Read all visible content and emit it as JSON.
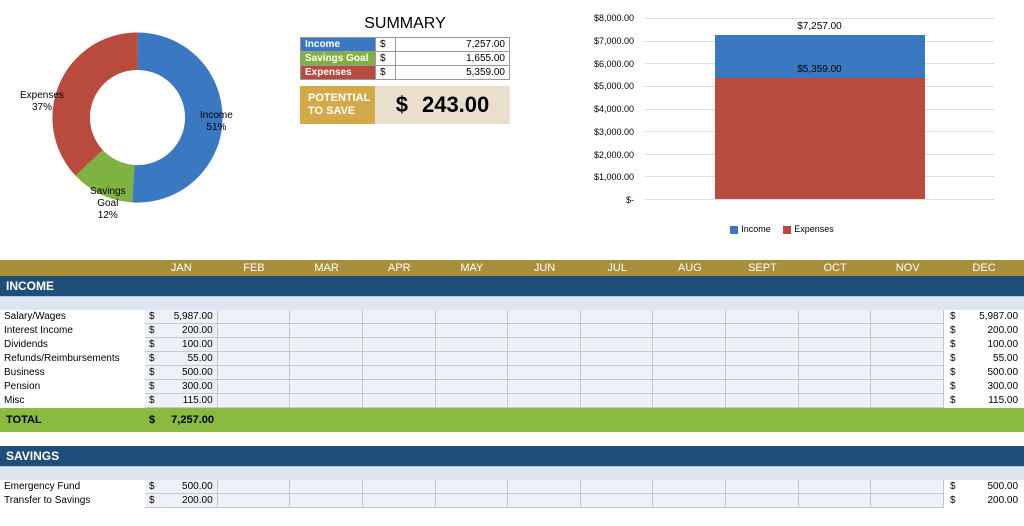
{
  "summary": {
    "title": "SUMMARY",
    "rows": [
      {
        "label": "Income",
        "color": "#3b78c2",
        "currency": "$",
        "value": "7,257.00"
      },
      {
        "label": "Savings Goal",
        "color": "#7fb241",
        "currency": "$",
        "value": "1,655.00"
      },
      {
        "label": "Expenses",
        "color": "#b94a3e",
        "currency": "$",
        "value": "5,359.00"
      }
    ],
    "potential": {
      "label": "POTENTIAL TO SAVE",
      "currency": "$",
      "value": "243.00"
    }
  },
  "donut": {
    "labels": {
      "income": "Income\n51%",
      "savings": "Savings\nGoal\n12%",
      "expenses": "Expenses\n37%"
    }
  },
  "bar": {
    "y_ticks": [
      "$8,000.00",
      "$7,000.00",
      "$6,000.00",
      "$5,000.00",
      "$4,000.00",
      "$3,000.00",
      "$2,000.00",
      "$1,000.00",
      "$-"
    ],
    "top_label": "$7,257.00",
    "inner_label": "$5,359.00",
    "legend": [
      {
        "name": "Income",
        "color": "#3b78c2"
      },
      {
        "name": "Expenses",
        "color": "#b94a3e"
      }
    ]
  },
  "months": [
    "JAN",
    "FEB",
    "MAR",
    "APR",
    "MAY",
    "JUN",
    "JUL",
    "AUG",
    "SEPT",
    "OCT",
    "NOV",
    "DEC"
  ],
  "income": {
    "header": "INCOME",
    "rows": [
      {
        "label": "Salary/Wages",
        "jan": "5,987.00",
        "total": "5,987.00"
      },
      {
        "label": "Interest Income",
        "jan": "200.00",
        "total": "200.00"
      },
      {
        "label": "Dividends",
        "jan": "100.00",
        "total": "100.00"
      },
      {
        "label": "Refunds/Reimbursements",
        "jan": "55.00",
        "total": "55.00"
      },
      {
        "label": "Business",
        "jan": "500.00",
        "total": "500.00"
      },
      {
        "label": "Pension",
        "jan": "300.00",
        "total": "300.00"
      },
      {
        "label": "Misc",
        "jan": "115.00",
        "total": "115.00"
      }
    ],
    "total": {
      "label": "TOTAL",
      "value": "7,257.00"
    }
  },
  "savings": {
    "header": "SAVINGS",
    "rows": [
      {
        "label": "Emergency Fund",
        "jan": "500.00",
        "total": "500.00"
      },
      {
        "label": "Transfer to Savings",
        "jan": "200.00",
        "total": "200.00"
      }
    ]
  },
  "currency": "$",
  "chart_data": [
    {
      "type": "pie",
      "title": "",
      "series": [
        {
          "name": "Income",
          "value": 51,
          "color": "#3b78c2"
        },
        {
          "name": "Expenses",
          "value": 37,
          "color": "#b94a3e"
        },
        {
          "name": "Savings Goal",
          "value": 12,
          "color": "#7fb241"
        }
      ],
      "note": "rendered as donut, percentages of total budget"
    },
    {
      "type": "bar",
      "title": "",
      "categories": [
        "(single stacked bar)"
      ],
      "series": [
        {
          "name": "Income",
          "values": [
            7257
          ],
          "color": "#3b78c2"
        },
        {
          "name": "Expenses",
          "values": [
            5359
          ],
          "color": "#b94a3e"
        }
      ],
      "ylabel": "$",
      "ylim": [
        0,
        8000
      ],
      "stacked_overlay": true
    }
  ]
}
